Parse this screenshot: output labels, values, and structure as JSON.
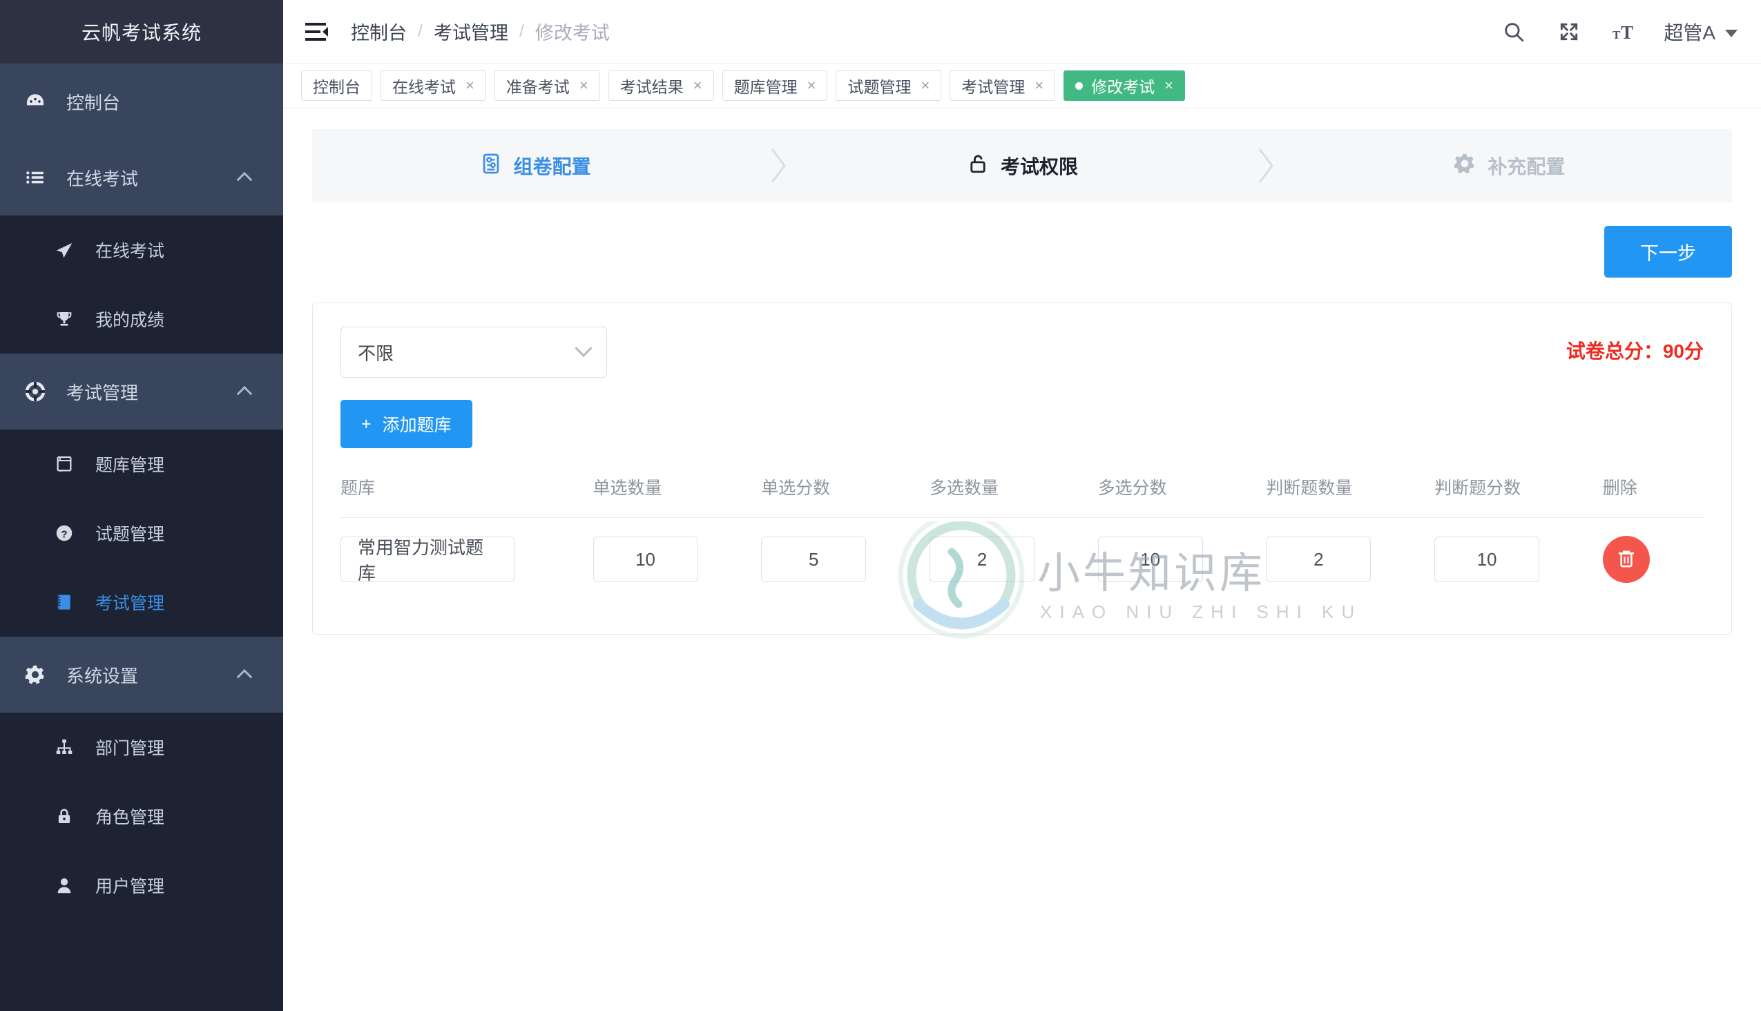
{
  "brand": {
    "title": "云帆考试系统"
  },
  "sidebar": {
    "groups": [
      {
        "label": "控制台",
        "icon": "dashboard-icon",
        "type": "single",
        "items": []
      },
      {
        "label": "在线考试",
        "icon": "list-icon",
        "type": "group",
        "items": [
          {
            "label": "在线考试",
            "icon": "paper-plane-icon",
            "active": false
          },
          {
            "label": "我的成绩",
            "icon": "trophy-icon",
            "active": false
          }
        ]
      },
      {
        "label": "考试管理",
        "icon": "lifebuoy-icon",
        "type": "group",
        "items": [
          {
            "label": "题库管理",
            "icon": "book-icon",
            "active": false
          },
          {
            "label": "试题管理",
            "icon": "question-circle-icon",
            "active": false
          },
          {
            "label": "考试管理",
            "icon": "notebook-icon",
            "active": true
          }
        ]
      },
      {
        "label": "系统设置",
        "icon": "gear-icon",
        "type": "group",
        "items": [
          {
            "label": "部门管理",
            "icon": "sitemap-icon",
            "active": false
          },
          {
            "label": "角色管理",
            "icon": "lock-icon",
            "active": false
          },
          {
            "label": "用户管理",
            "icon": "user-icon",
            "active": false
          }
        ]
      }
    ]
  },
  "topbar": {
    "hamburger_icon": "menu-fold-icon",
    "breadcrumb": [
      "控制台",
      "考试管理",
      "修改考试"
    ],
    "separator": "/",
    "icons": [
      "search-icon",
      "fullscreen-icon",
      "font-size-icon"
    ],
    "user": "超管A"
  },
  "tabs": [
    {
      "label": "控制台",
      "closable": false,
      "active": false
    },
    {
      "label": "在线考试",
      "closable": true,
      "active": false
    },
    {
      "label": "准备考试",
      "closable": true,
      "active": false
    },
    {
      "label": "考试结果",
      "closable": true,
      "active": false
    },
    {
      "label": "题库管理",
      "closable": true,
      "active": false
    },
    {
      "label": "试题管理",
      "closable": true,
      "active": false
    },
    {
      "label": "考试管理",
      "closable": true,
      "active": false
    },
    {
      "label": "修改考试",
      "closable": true,
      "active": true
    }
  ],
  "tab_close_glyph": "×",
  "steps": [
    {
      "label": "组卷配置",
      "icon": "paper-config-icon",
      "state": "done"
    },
    {
      "label": "考试权限",
      "icon": "unlock-icon",
      "state": "current"
    },
    {
      "label": "补充配置",
      "icon": "gear-icon",
      "state": "todo"
    }
  ],
  "actions": {
    "next_label": "下一步"
  },
  "filter": {
    "selected": "不限",
    "chevron_icon": "chevron-down-icon"
  },
  "add_bank": {
    "label": "添加题库",
    "plus": "+"
  },
  "total_score": {
    "label": "试卷总分：",
    "value": "90分",
    "color": "#ed2b1f"
  },
  "table": {
    "headers": [
      "题库",
      "单选数量",
      "单选分数",
      "多选数量",
      "多选分数",
      "判断题数量",
      "判断题分数",
      "删除"
    ],
    "rows": [
      {
        "bank": "常用智力测试题库",
        "single_count": "10",
        "single_score": "5",
        "multi_count": "2",
        "multi_score": "10",
        "judge_count": "2",
        "judge_score": "10",
        "delete_icon": "trash-icon"
      }
    ]
  },
  "watermark": {
    "main": "小牛知识库",
    "sub": "XIAO NIU ZHI SHI KU"
  }
}
